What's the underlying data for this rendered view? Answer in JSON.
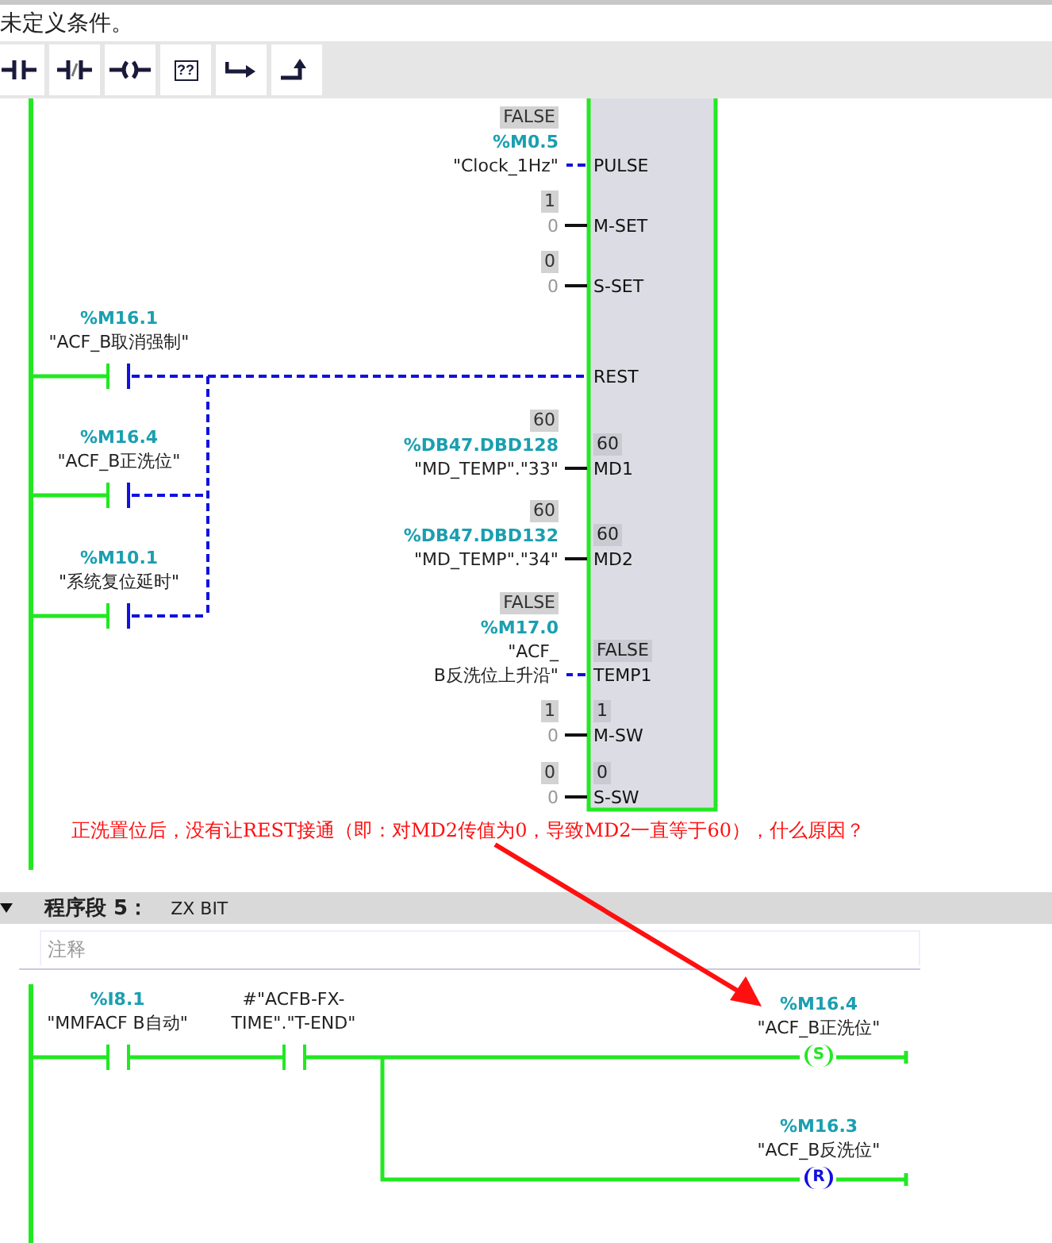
{
  "editor": {
    "condition_text": "未定义条件。"
  },
  "toolbar": [
    {
      "kind": "no_contact"
    },
    {
      "kind": "nc_contact"
    },
    {
      "kind": "coil"
    },
    {
      "kind": "empty_box",
      "glyph": "??"
    },
    {
      "kind": "jump"
    },
    {
      "kind": "return"
    }
  ],
  "network_4": {
    "contacts": [
      {
        "address": "%M16.1",
        "tag_lines": [
          "\"ACF_B取消强制\""
        ],
        "closed": false
      },
      {
        "address": "%M16.4",
        "tag_lines": [
          "\"ACF_B正洗位\""
        ],
        "closed": false
      },
      {
        "address": "%M10.1",
        "tag_lines": [
          "\"系统复位延时\""
        ],
        "closed": false
      }
    ],
    "block_pins": [
      {
        "name": "PULSE",
        "kind": "bool",
        "monitor": "FALSE",
        "address": "%M0.5",
        "operand_lines": [
          "\"Clock_1Hz\""
        ],
        "signal": false
      },
      {
        "name": "M-SET",
        "kind": "value",
        "monitor": "1",
        "operand_lines": [
          "0"
        ]
      },
      {
        "name": "S-SET",
        "kind": "value",
        "monitor": "0",
        "operand_lines": [
          "0"
        ]
      },
      {
        "name": "REST",
        "kind": "contacts"
      },
      {
        "name": "MD1",
        "kind": "value",
        "monitor": "60",
        "address": "%DB47.DBD128",
        "operand_lines": [
          "\"MD_TEMP\".\"33\""
        ],
        "inner_monitor": "60"
      },
      {
        "name": "MD2",
        "kind": "value",
        "monitor": "60",
        "address": "%DB47.DBD132",
        "operand_lines": [
          "\"MD_TEMP\".\"34\""
        ],
        "inner_monitor": "60"
      },
      {
        "name": "TEMP1",
        "kind": "bool",
        "monitor": "FALSE",
        "address": "%M17.0",
        "operand_lines": [
          "\"ACF_",
          "B反洗位上升沿\""
        ],
        "signal": false,
        "inner_monitor": "FALSE"
      },
      {
        "name": "M-SW",
        "kind": "value",
        "monitor": "1",
        "operand_lines": [
          "0"
        ],
        "inner_monitor": "1"
      },
      {
        "name": "S-SW",
        "kind": "value",
        "monitor": "0",
        "operand_lines": [
          "0"
        ],
        "inner_monitor": "0"
      }
    ],
    "note": "正洗置位后，没有让REST接通（即：对MD2传值为0，导致MD2一直等于60），什么原因？"
  },
  "network_5": {
    "title": "程序段 5：",
    "name": "ZX BIT",
    "comment_placeholder": "注释",
    "contacts": [
      {
        "address": "%I8.1",
        "tag_lines": [
          "\"MMFACF B自动\""
        ],
        "closed": true
      },
      {
        "tag_lines": [
          "#\"ACFB-FX-",
          "TIME\".\"T-END\""
        ],
        "closed": true
      }
    ],
    "coils": [
      {
        "letter": "S",
        "address": "%M16.4",
        "tag_lines": [
          "\"ACF_B正洗位\""
        ],
        "energized": true
      },
      {
        "letter": "R",
        "address": "%M16.3",
        "tag_lines": [
          "\"ACF_B反洗位\""
        ],
        "energized": false
      }
    ]
  }
}
